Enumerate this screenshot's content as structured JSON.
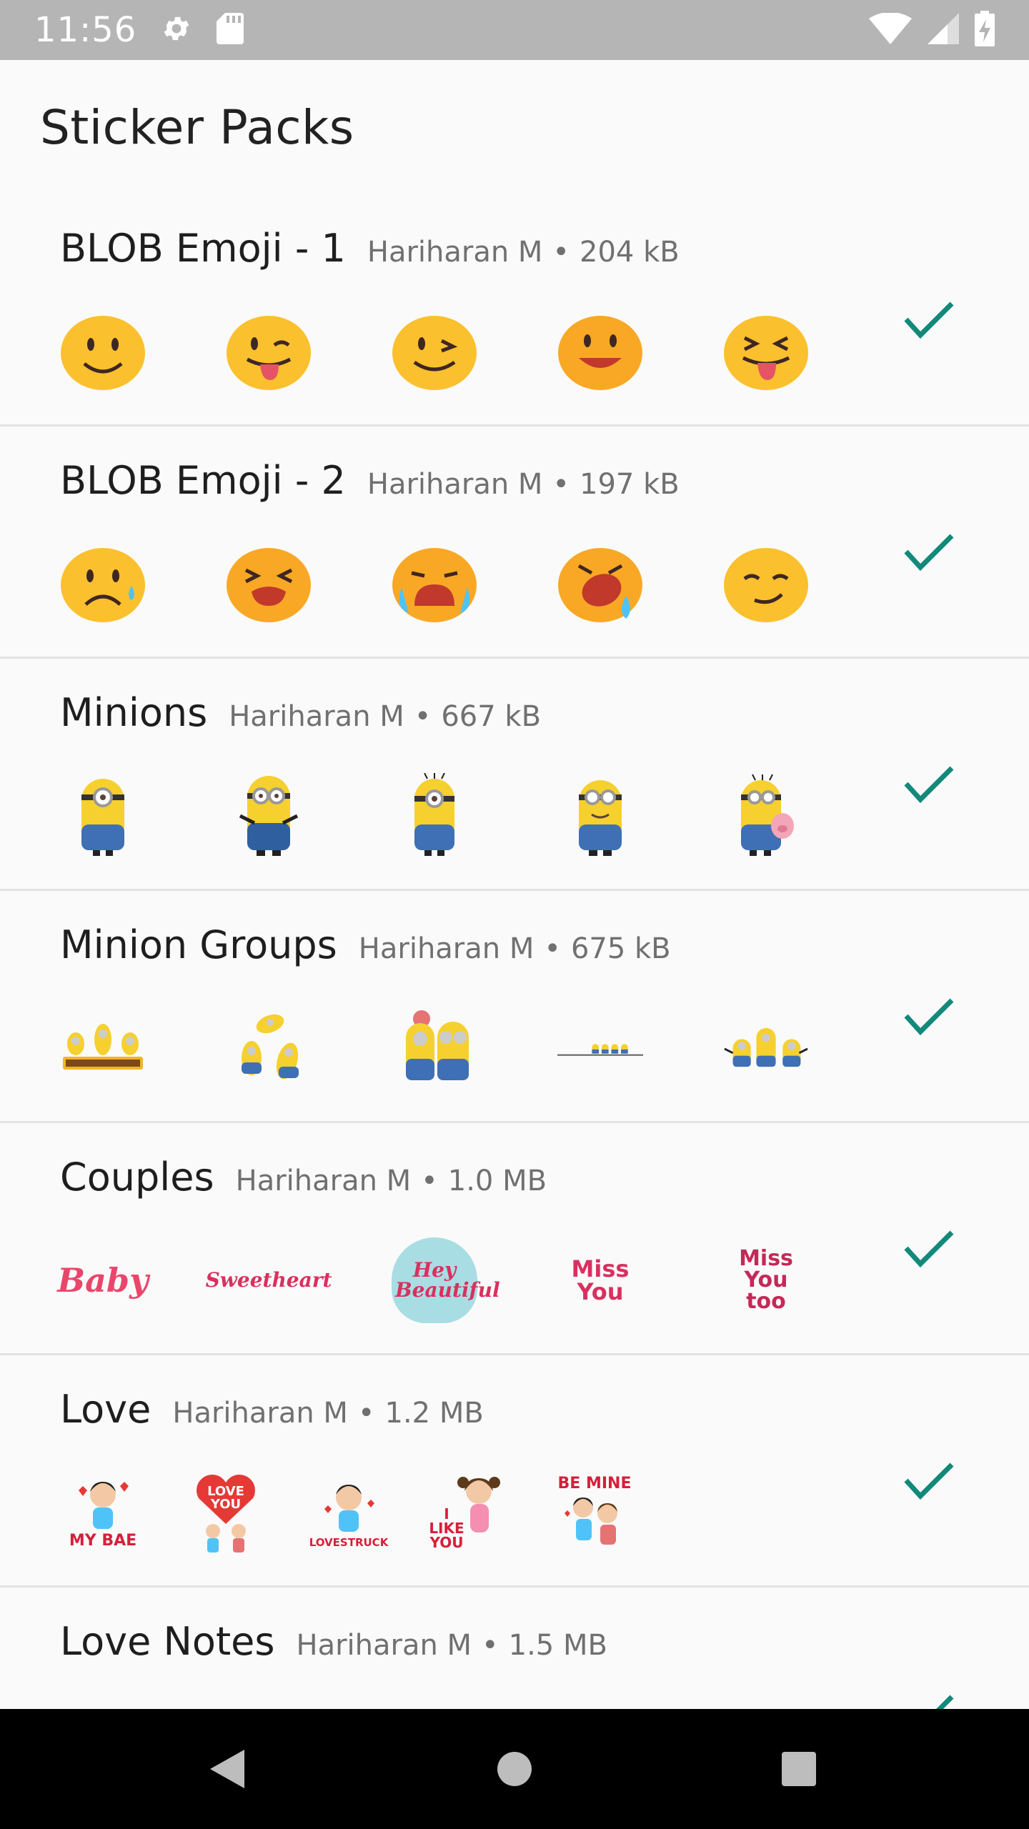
{
  "status_bar": {
    "time": "11:56"
  },
  "page": {
    "title": "Sticker Packs"
  },
  "packs": [
    {
      "name": "BLOB Emoji - 1",
      "author": "Hariharan M",
      "separator": "•",
      "size": "204 kB",
      "stickers": [
        "smiling-face-sticker",
        "tongue-wink-face-sticker",
        "winking-face-sticker",
        "open-mouth-smile-sticker",
        "squinting-tongue-face-sticker"
      ]
    },
    {
      "name": "BLOB Emoji - 2",
      "author": "Hariharan M",
      "separator": "•",
      "size": "197 kB",
      "stickers": [
        "sad-tear-face-sticker",
        "crying-face-sticker",
        "sobbing-face-sticker",
        "loud-crying-face-sticker",
        "smirk-face-sticker"
      ]
    },
    {
      "name": "Minions",
      "author": "Hariharan M",
      "separator": "•",
      "size": "667 kB",
      "stickers": [
        "minion-one-eye-sticker",
        "minion-two-eyes-sticker",
        "minion-hair-sticker",
        "minion-goggles-sticker",
        "minion-pig-sticker"
      ]
    },
    {
      "name": "Minion Groups",
      "author": "Hariharan M",
      "separator": "•",
      "size": "675 kB",
      "stickers": [
        "minions-logo-sticker",
        "minions-tumbling-sticker",
        "minion-pair-sticker",
        "minions-tightrope-sticker",
        "minion-trio-sticker"
      ]
    },
    {
      "name": "Couples",
      "author": "Hariharan M",
      "separator": "•",
      "size": "1.0 MB",
      "stickers": [
        {
          "text": "Baby",
          "color": "#e8476b"
        },
        {
          "text": "Sweetheart",
          "color": "#d9305f"
        },
        {
          "text": "Hey Beautiful",
          "color": "#d9305f"
        },
        {
          "text": "Miss You",
          "color": "#d9305f"
        },
        {
          "text": "Miss You too",
          "color": "#c62858"
        }
      ]
    },
    {
      "name": "Love",
      "author": "Hariharan M",
      "separator": "•",
      "size": "1.2 MB",
      "stickers": [
        {
          "text": "MY BAE",
          "color": "#d61f3a"
        },
        {
          "text": "LOVE YOU",
          "color": "#ffffff"
        },
        {
          "text": "LOVESTRUCK",
          "color": "#d61f3a"
        },
        {
          "text": "I LIKE YOU",
          "color": "#d61f3a"
        },
        {
          "text": "BE MINE",
          "color": "#d61f3a"
        }
      ]
    },
    {
      "name": "Love Notes",
      "author": "Hariharan M",
      "separator": "•",
      "size": "1.5 MB",
      "stickers": []
    }
  ],
  "colors": {
    "check": "#12897a",
    "emoji_yellow": "#fbc02d",
    "status_bar": "#b5b5b5"
  }
}
